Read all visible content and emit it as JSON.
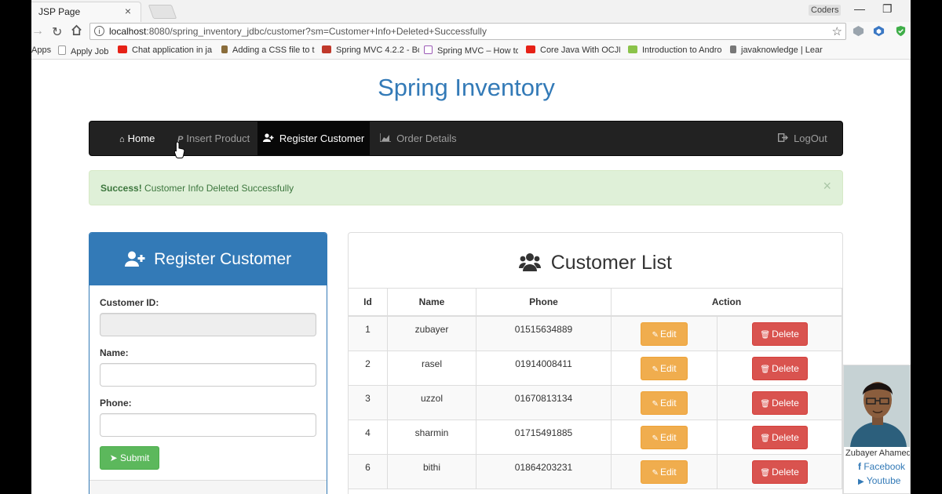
{
  "browser": {
    "tab_title": "JSP Page",
    "tab_close": "×",
    "profile_name": "Coders",
    "window_minimize": "—",
    "window_restore": "❐",
    "url_host": "localhost",
    "url_rest": ":8080/spring_inventory_jdbc/customer?sm=Customer+Info+Deleted+Successfully",
    "bookmarks": [
      {
        "label": "Apps",
        "color": "#4285f4"
      },
      {
        "label": "Apply Job",
        "color": "#999999"
      },
      {
        "label": "Chat application in ja",
        "color": "#e62117"
      },
      {
        "label": "Adding a CSS file to t",
        "color": "#8a6d3b"
      },
      {
        "label": "Spring MVC 4.2.2 - Bo",
        "color": "#c0392b"
      },
      {
        "label": "Spring MVC – How to",
        "color": "#9b59b6"
      },
      {
        "label": "Core Java With OCJP/",
        "color": "#e62117"
      },
      {
        "label": "Introduction to Andro",
        "color": "#8bc34a"
      },
      {
        "label": "javaknowledge | Lear",
        "color": "#777777"
      }
    ]
  },
  "page": {
    "title": "Spring Inventory"
  },
  "navbar": {
    "items": [
      {
        "label": "Home",
        "icon": "home-icon"
      },
      {
        "label": "Insert Product",
        "icon": "paypal-icon"
      },
      {
        "label": "Register Customer",
        "icon": "user-plus-icon"
      },
      {
        "label": "Order Details",
        "icon": "area-chart-icon"
      }
    ],
    "logout": "LogOut"
  },
  "alert": {
    "strong": "Success!",
    "text": "Customer Info Deleted Successfully",
    "close": "×"
  },
  "register": {
    "title": "Register Customer",
    "id_label": "Customer ID:",
    "name_label": "Name:",
    "phone_label": "Phone:",
    "submit": "Submit"
  },
  "customer_list": {
    "title": "Customer List",
    "headers": {
      "id": "Id",
      "name": "Name",
      "phone": "Phone",
      "action": "Action"
    },
    "edit_label": "Edit",
    "delete_label": "Delete",
    "rows": [
      {
        "id": "1",
        "name": "zubayer",
        "phone": "01515634889"
      },
      {
        "id": "2",
        "name": "rasel",
        "phone": "01914008411"
      },
      {
        "id": "3",
        "name": "uzzol",
        "phone": "01670813134"
      },
      {
        "id": "4",
        "name": "sharmin",
        "phone": "01715491885"
      },
      {
        "id": "6",
        "name": "bithi",
        "phone": "01864203231"
      }
    ]
  },
  "profile": {
    "name": "Zubayer Ahamed",
    "facebook": "Facebook",
    "youtube": "Youtube"
  },
  "colors": {
    "primary": "#337ab7",
    "success": "#5cb85c",
    "warning": "#f0ad4e",
    "danger": "#d9534f"
  }
}
